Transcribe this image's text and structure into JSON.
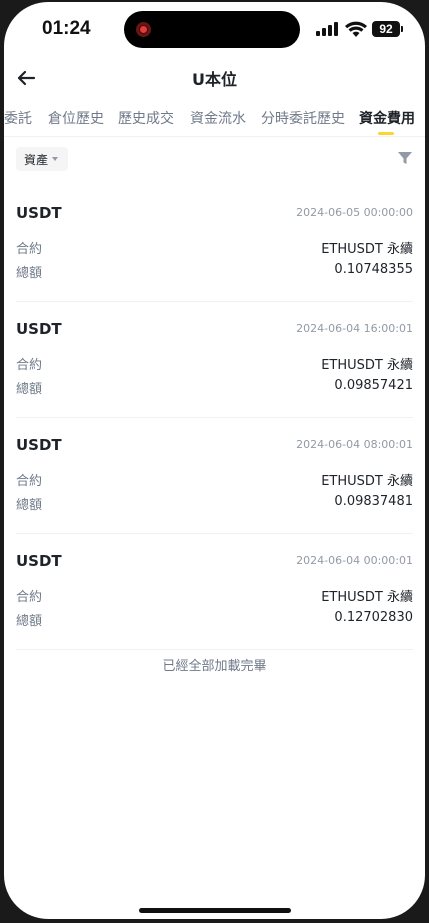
{
  "status_bar": {
    "time": "01:24",
    "battery": "92"
  },
  "header": {
    "title": "U本位"
  },
  "tabs": [
    {
      "label": "委託"
    },
    {
      "label": "倉位歷史"
    },
    {
      "label": "歷史成交"
    },
    {
      "label": "資金流水"
    },
    {
      "label": "分時委託歷史"
    },
    {
      "label": "資金費用",
      "active": true
    }
  ],
  "filter": {
    "asset_label": "資產"
  },
  "records": [
    {
      "asset": "USDT",
      "time": "2024-06-05 00:00:00",
      "contract_label": "合約",
      "contract": "ETHUSDT 永續",
      "amount_label": "總額",
      "amount": "0.10748355"
    },
    {
      "asset": "USDT",
      "time": "2024-06-04 16:00:01",
      "contract_label": "合約",
      "contract": "ETHUSDT 永續",
      "amount_label": "總額",
      "amount": "0.09857421"
    },
    {
      "asset": "USDT",
      "time": "2024-06-04 08:00:01",
      "contract_label": "合約",
      "contract": "ETHUSDT 永續",
      "amount_label": "總額",
      "amount": "0.09837481"
    },
    {
      "asset": "USDT",
      "time": "2024-06-04 00:00:01",
      "contract_label": "合約",
      "contract": "ETHUSDT 永續",
      "amount_label": "總額",
      "amount": "0.12702830"
    }
  ],
  "end_note": "已經全部加載完畢",
  "colors": {
    "accent": "#fcd535",
    "text_primary": "#1e2329",
    "text_secondary": "#707a8a"
  }
}
